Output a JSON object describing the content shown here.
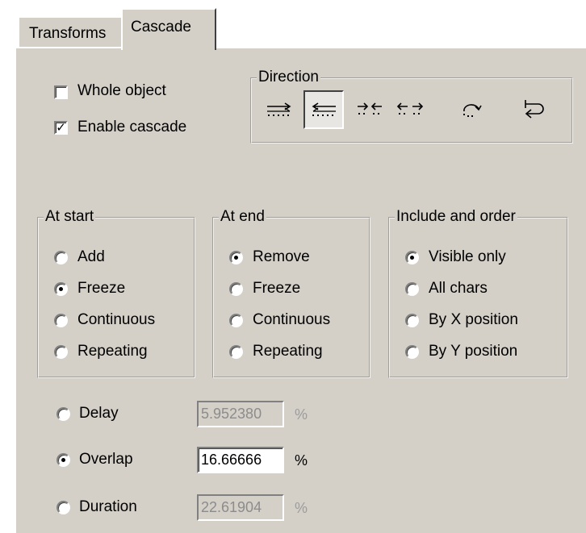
{
  "tabs": [
    {
      "label": "Transforms",
      "active": false
    },
    {
      "label": "Cascade",
      "active": true
    }
  ],
  "options": {
    "whole_object": {
      "label": "Whole object",
      "checked": false
    },
    "enable_cascade": {
      "label": "Enable cascade",
      "checked": true
    }
  },
  "direction": {
    "title": "Direction",
    "buttons": [
      {
        "icon": "arrow-right-dotted-icon",
        "pressed": false
      },
      {
        "icon": "arrow-left-dotted-icon",
        "pressed": true
      },
      {
        "icon": "arrows-converge-icon",
        "pressed": false
      },
      {
        "icon": "arrows-diverge-icon",
        "pressed": false
      },
      {
        "icon": "rotate-cycle-icon",
        "pressed": false
      },
      {
        "icon": "loop-arrow-icon",
        "pressed": false
      }
    ]
  },
  "at_start": {
    "title": "At start",
    "items": [
      {
        "label": "Add",
        "selected": false
      },
      {
        "label": "Freeze",
        "selected": true
      },
      {
        "label": "Continuous",
        "selected": false
      },
      {
        "label": "Repeating",
        "selected": false
      }
    ]
  },
  "at_end": {
    "title": "At end",
    "items": [
      {
        "label": "Remove",
        "selected": true
      },
      {
        "label": "Freeze",
        "selected": false
      },
      {
        "label": "Continuous",
        "selected": false
      },
      {
        "label": "Repeating",
        "selected": false
      }
    ]
  },
  "include_order": {
    "title": "Include and order",
    "items": [
      {
        "label": "Visible only",
        "selected": true
      },
      {
        "label": "All chars",
        "selected": false
      },
      {
        "label": "By X position",
        "selected": false
      },
      {
        "label": "By Y position",
        "selected": false
      }
    ]
  },
  "timing": [
    {
      "label": "Delay",
      "value": "5.952380",
      "unit": "%",
      "selected": false,
      "enabled": false
    },
    {
      "label": "Overlap",
      "value": "16.66666",
      "unit": "%",
      "selected": true,
      "enabled": true
    },
    {
      "label": "Duration",
      "value": "22.61904",
      "unit": "%",
      "selected": false,
      "enabled": false
    }
  ]
}
